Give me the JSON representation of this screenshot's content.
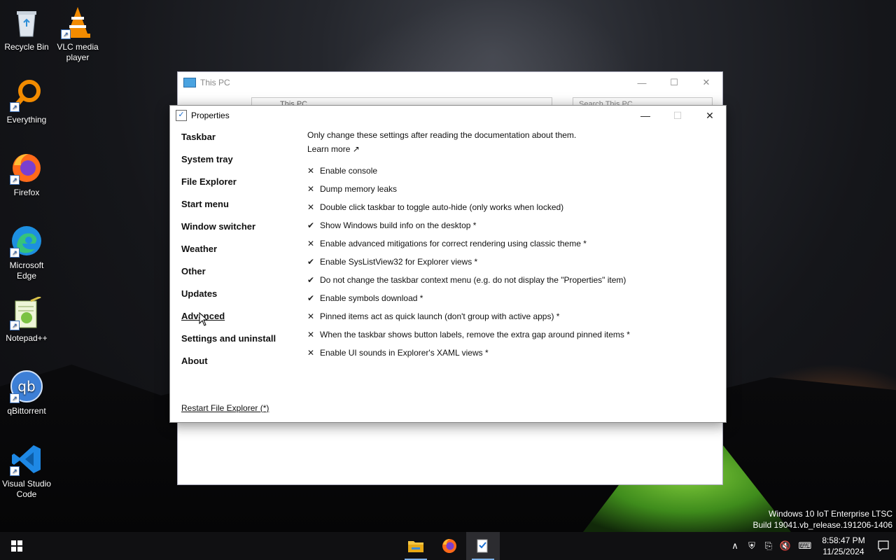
{
  "desktop": {
    "icons": [
      {
        "label": "Recycle Bin"
      },
      {
        "label": "VLC media player"
      },
      {
        "label": "Everything"
      },
      {
        "label": "Firefox"
      },
      {
        "label": "Microsoft Edge"
      },
      {
        "label": "Notepad++"
      },
      {
        "label": "qBittorrent"
      },
      {
        "label": "Visual Studio Code"
      }
    ]
  },
  "explorer": {
    "title": "This PC",
    "address": "This PC",
    "search_placeholder": "Search This PC"
  },
  "dialog": {
    "title": "Properties",
    "nav": [
      "Taskbar",
      "System tray",
      "File Explorer",
      "Start menu",
      "Window switcher",
      "Weather",
      "Other",
      "Updates",
      "Advanced",
      "Settings and uninstall",
      "About"
    ],
    "active_nav": "Advanced",
    "restart_link": "Restart File Explorer (*)",
    "intro": "Only change these settings after reading the documentation about them.",
    "learn_more": "Learn more ↗",
    "options": [
      {
        "label": "Enable console",
        "checked": false
      },
      {
        "label": "Dump memory leaks",
        "checked": false
      },
      {
        "label": "Double click taskbar to toggle auto-hide (only works when locked)",
        "checked": false
      },
      {
        "label": "Show Windows build info on the desktop *",
        "checked": true
      },
      {
        "label": "Enable advanced mitigations for correct rendering using classic theme *",
        "checked": false
      },
      {
        "label": "Enable SysListView32 for Explorer views *",
        "checked": true
      },
      {
        "label": "Do not change the taskbar context menu (e.g. do not display the \"Properties\" item)",
        "checked": true
      },
      {
        "label": "Enable symbols download *",
        "checked": true
      },
      {
        "label": "Pinned items act as quick launch (don't group with active apps) *",
        "checked": false
      },
      {
        "label": "When the taskbar shows button labels, remove the extra gap around pinned items *",
        "checked": false
      },
      {
        "label": "Enable UI sounds in Explorer's XAML views *",
        "checked": false
      }
    ],
    "check_glyph": "✔",
    "cross_glyph": "✕"
  },
  "build_info": {
    "line1": "Windows 10 IoT Enterprise LTSC",
    "line2": "Build 19041.vb_release.191206-1406"
  },
  "taskbar": {
    "time": "8:58:47 PM",
    "date": "11/25/2024"
  },
  "colors": {
    "accent": "#1b6fd1",
    "taskbar_bg": "#101012"
  }
}
